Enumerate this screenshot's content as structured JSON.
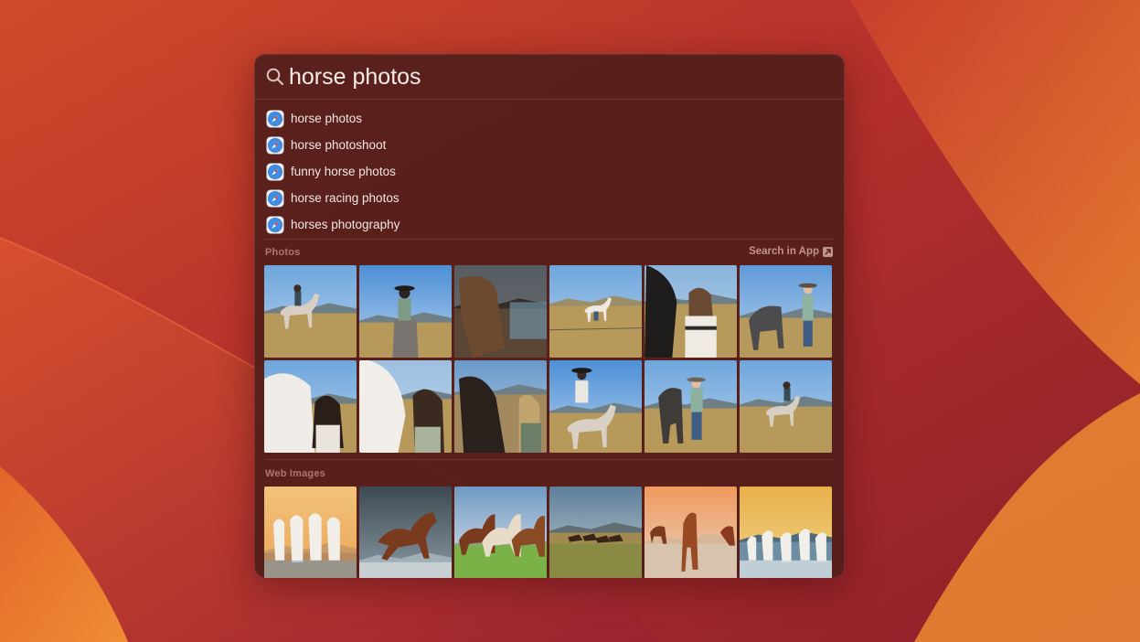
{
  "search": {
    "query": "horse photos"
  },
  "suggestions": [
    {
      "label": "horse photos",
      "icon": "safari-compass-icon"
    },
    {
      "label": "horse photoshoot",
      "icon": "safari-compass-icon"
    },
    {
      "label": "funny horse photos",
      "icon": "safari-compass-icon"
    },
    {
      "label": "horse racing photos",
      "icon": "safari-compass-icon"
    },
    {
      "label": "horses photography",
      "icon": "safari-compass-icon"
    }
  ],
  "photos": {
    "title": "Photos",
    "search_in_app_label": "Search in App",
    "count": 12
  },
  "web_images": {
    "title": "Web Images",
    "count": 6
  },
  "colors": {
    "wallpaper_red": "#b8332a",
    "wallpaper_orange": "#e8792c",
    "panel_bg": "#521e1a",
    "text": "#f6ecea"
  }
}
